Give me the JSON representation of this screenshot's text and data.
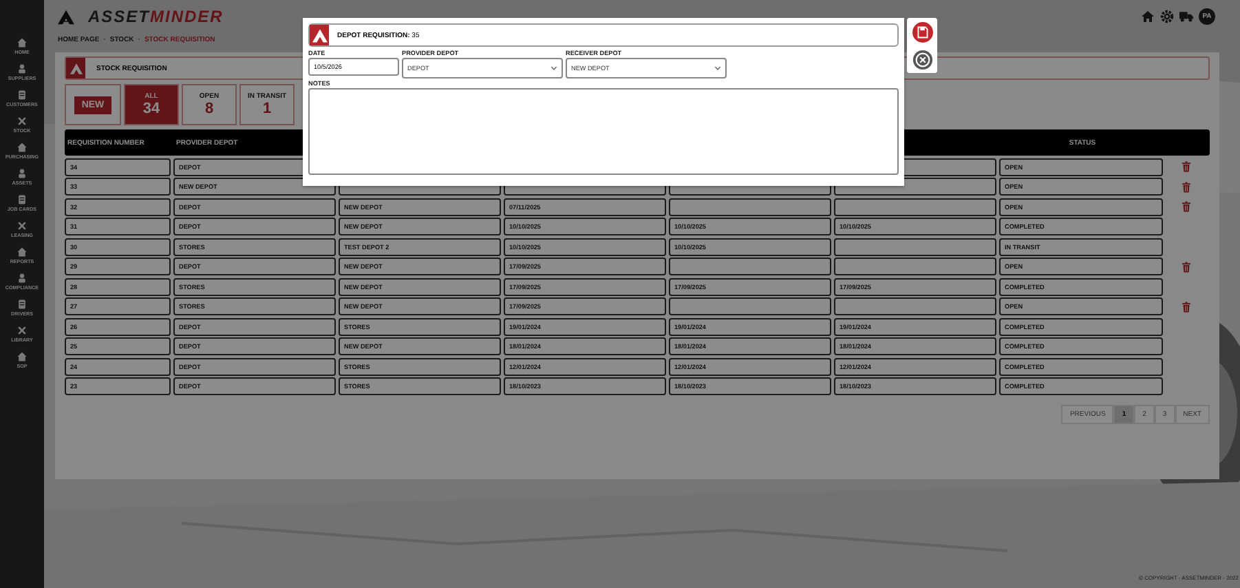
{
  "sidebar": {
    "items": [
      {
        "label": "HOME"
      },
      {
        "label": "SUPPLIERS"
      },
      {
        "label": "CUSTOMERS"
      },
      {
        "label": "STOCK"
      },
      {
        "label": "PURCHASING"
      },
      {
        "label": "ASSETS"
      },
      {
        "label": "JOB CARDS"
      },
      {
        "label": "LEASING"
      },
      {
        "label": "REPORTS"
      },
      {
        "label": "COMPLIANCE"
      },
      {
        "label": "DRIVERS"
      },
      {
        "label": "LIBRARY"
      },
      {
        "label": "SOP"
      }
    ]
  },
  "header": {
    "logo_a": "ASSET",
    "logo_b": "MINDER",
    "avatar": "PA"
  },
  "breadcrumb": [
    {
      "label": "HOME PAGE",
      "selected": false
    },
    {
      "label": "STOCK",
      "separator": "·",
      "selected": false
    },
    {
      "label": "STOCK REQUISITION",
      "separator": "·",
      "selected": true
    }
  ],
  "panel": {
    "title": "STOCK REQUISITION",
    "new_button": "NEW",
    "stats": [
      {
        "label": "ALL",
        "count": "34",
        "selected": true
      },
      {
        "label": "OPEN",
        "count": "8",
        "selected": false
      },
      {
        "label": "IN TRANSIT",
        "count": "1",
        "selected": false
      }
    ]
  },
  "table": {
    "columns": [
      {
        "label": "REQUISITION NUMBER"
      },
      {
        "label": "PROVIDER DEPOT"
      },
      {
        "label": "STATUS"
      }
    ],
    "rows": [
      {
        "number": "34",
        "provider": "DEPOT",
        "status": "OPEN",
        "deletable": true
      },
      {
        "number": "33",
        "provider": "NEW DEPOT",
        "status": "OPEN",
        "deletable": true
      },
      {
        "number": "32",
        "provider": "DEPOT",
        "receiver": "NEW DEPOT",
        "date": "07/11/2025",
        "status": "OPEN",
        "deletable": true
      },
      {
        "number": "31",
        "provider": "DEPOT",
        "receiver": "NEW DEPOT",
        "date": "10/10/2025",
        "sent": "10/10/2025",
        "received": "10/10/2025",
        "status": "COMPLETED",
        "deletable": false
      },
      {
        "number": "30",
        "provider": "STORES",
        "receiver": "TEST DEPOT 2",
        "date": "10/10/2025",
        "sent": "10/10/2025",
        "status": "IN TRANSIT",
        "deletable": false
      },
      {
        "number": "29",
        "provider": "DEPOT",
        "receiver": "NEW DEPOT",
        "date": "17/09/2025",
        "status": "OPEN",
        "deletable": true
      },
      {
        "number": "28",
        "provider": "STORES",
        "receiver": "NEW DEPOT",
        "date": "17/09/2025",
        "sent": "17/09/2025",
        "received": "17/09/2025",
        "status": "COMPLETED",
        "deletable": false
      },
      {
        "number": "27",
        "provider": "STORES",
        "receiver": "NEW DEPOT",
        "date": "17/09/2025",
        "status": "OPEN",
        "deletable": true
      },
      {
        "number": "26",
        "provider": "DEPOT",
        "receiver": "STORES",
        "date": "19/01/2024",
        "sent": "19/01/2024",
        "received": "19/01/2024",
        "status": "COMPLETED",
        "deletable": false
      },
      {
        "number": "25",
        "provider": "DEPOT",
        "receiver": "NEW DEPOT",
        "date": "18/01/2024",
        "sent": "18/01/2024",
        "received": "18/01/2024",
        "status": "COMPLETED",
        "deletable": false
      },
      {
        "number": "24",
        "provider": "DEPOT",
        "receiver": "STORES",
        "date": "12/01/2024",
        "sent": "12/01/2024",
        "received": "12/01/2024",
        "status": "COMPLETED",
        "deletable": false
      },
      {
        "number": "23",
        "provider": "DEPOT",
        "receiver": "STORES",
        "date": "18/10/2023",
        "sent": "18/10/2023",
        "received": "18/10/2023",
        "status": "COMPLETED",
        "deletable": false
      }
    ]
  },
  "pagination": {
    "previous": "PREVIOUS",
    "pages": [
      {
        "label": "1",
        "selected": true
      },
      {
        "label": "2",
        "selected": false
      },
      {
        "label": "3",
        "selected": false
      }
    ],
    "next": "NEXT"
  },
  "footer": "© COPYRIGHT - ASSETMINDER - 2022",
  "modal": {
    "title": "DEPOT REQUISITION:",
    "number": "35",
    "date": {
      "label": "DATE",
      "value": "10/5/2026"
    },
    "provider": {
      "label": "PROVIDER DEPOT",
      "value": "DEPOT"
    },
    "receiver": {
      "label": "RECEIVER DEPOT",
      "value": "NEW DEPOT"
    },
    "notes": {
      "label": "NOTES"
    }
  }
}
